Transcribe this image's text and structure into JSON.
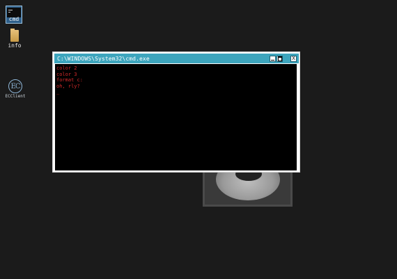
{
  "desktop": {
    "icons": [
      {
        "name": "cmd",
        "label": "cmd"
      },
      {
        "name": "info",
        "label": "info"
      },
      {
        "name": "ec",
        "glyph": "EC",
        "label": "ECClient"
      }
    ]
  },
  "window": {
    "title": "C:\\WINDOWS\\System32\\cmd.exe",
    "buttons": {
      "minimize": "_",
      "maximize": "□",
      "close": "X"
    },
    "console": {
      "lines": [
        "color 2",
        "color 3",
        "format c:",
        "oh, rly?"
      ],
      "cursor": "_",
      "text_color": "#d42a2a",
      "background": "#000000"
    },
    "titlebar_color": "#3da5bd"
  }
}
